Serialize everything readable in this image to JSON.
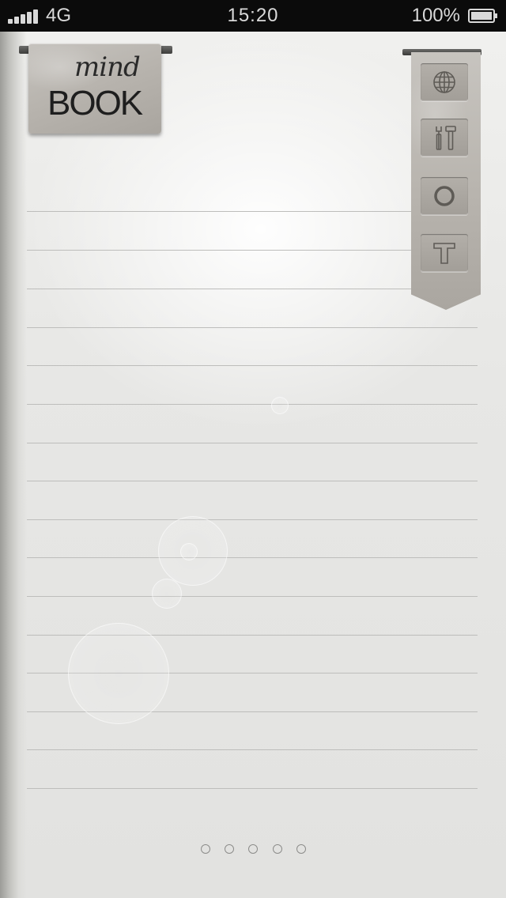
{
  "status_bar": {
    "carrier": "4G",
    "time": "15:20",
    "battery": "100%",
    "signal_bars": 5
  },
  "logo": {
    "script_text": "mind",
    "main_text": "BOOK"
  },
  "toolbar": {
    "items": [
      {
        "icon": "globe-icon",
        "label": "browser"
      },
      {
        "icon": "tools-icon",
        "label": "settings"
      },
      {
        "icon": "circle-icon",
        "label": "circle"
      },
      {
        "icon": "text-icon",
        "label": "text"
      }
    ]
  },
  "pager": {
    "total": 5,
    "current": 1
  },
  "colors": {
    "paper": "#e9e9e7",
    "rule": "#bdbdbb",
    "status_bar": "#0b0b0b",
    "stone": "#b8b4ae"
  }
}
